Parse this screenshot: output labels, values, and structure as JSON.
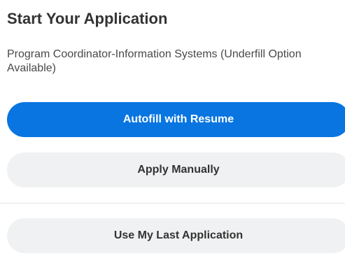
{
  "header": {
    "title": "Start Your Application"
  },
  "job": {
    "name": "Program Coordinator-Information Systems (Underfill Option Available)"
  },
  "actions": {
    "autofill_label": "Autofill with Resume",
    "manual_label": "Apply Manually",
    "last_application_label": "Use My Last Application"
  },
  "colors": {
    "primary": "#0875e1",
    "secondary_bg": "#f0f1f2",
    "text": "#333333"
  }
}
